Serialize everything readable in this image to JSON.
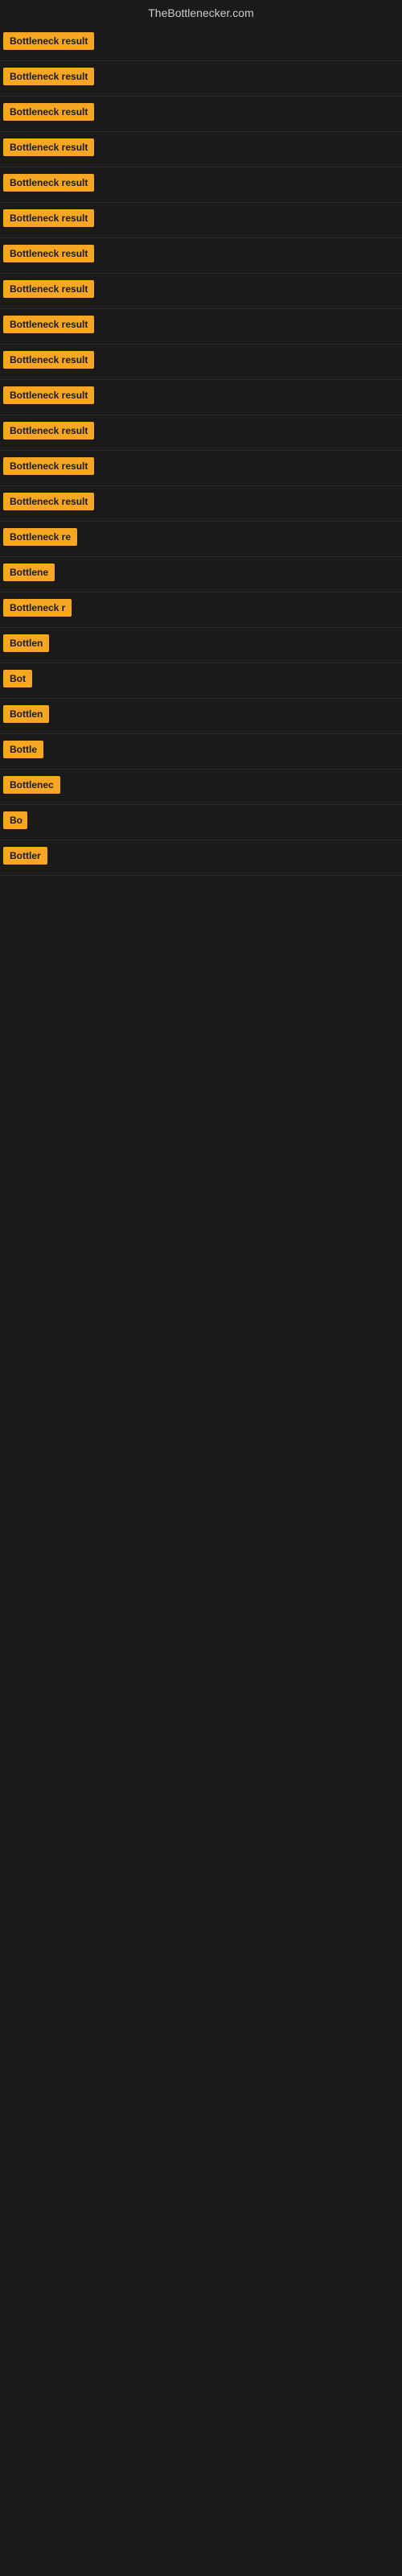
{
  "site": {
    "title": "TheBottlenecker.com"
  },
  "rows": [
    {
      "id": 0,
      "label": "Bottleneck result"
    },
    {
      "id": 1,
      "label": "Bottleneck result"
    },
    {
      "id": 2,
      "label": "Bottleneck result"
    },
    {
      "id": 3,
      "label": "Bottleneck result"
    },
    {
      "id": 4,
      "label": "Bottleneck result"
    },
    {
      "id": 5,
      "label": "Bottleneck result"
    },
    {
      "id": 6,
      "label": "Bottleneck result"
    },
    {
      "id": 7,
      "label": "Bottleneck result"
    },
    {
      "id": 8,
      "label": "Bottleneck result"
    },
    {
      "id": 9,
      "label": "Bottleneck result"
    },
    {
      "id": 10,
      "label": "Bottleneck result"
    },
    {
      "id": 11,
      "label": "Bottleneck result"
    },
    {
      "id": 12,
      "label": "Bottleneck result"
    },
    {
      "id": 13,
      "label": "Bottleneck result"
    },
    {
      "id": 14,
      "label": "Bottleneck re"
    },
    {
      "id": 15,
      "label": "Bottlene"
    },
    {
      "id": 16,
      "label": "Bottleneck r"
    },
    {
      "id": 17,
      "label": "Bottlen"
    },
    {
      "id": 18,
      "label": "Bot"
    },
    {
      "id": 19,
      "label": "Bottlen"
    },
    {
      "id": 20,
      "label": "Bottle"
    },
    {
      "id": 21,
      "label": "Bottlenec"
    },
    {
      "id": 22,
      "label": "Bo"
    },
    {
      "id": 23,
      "label": "Bottler"
    }
  ]
}
